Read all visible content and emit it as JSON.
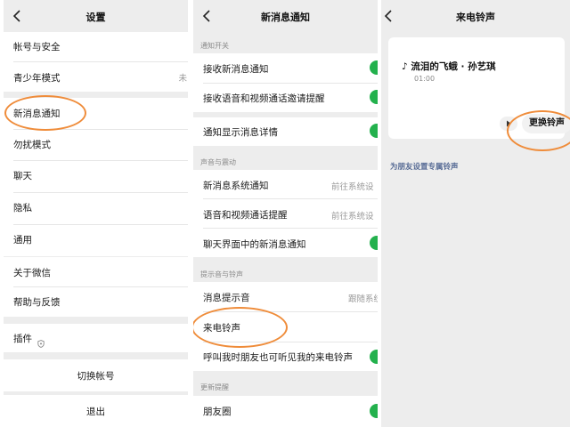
{
  "settings": {
    "title": "设置",
    "items": [
      {
        "label": "帐号与安全"
      },
      {
        "label": "青少年模式",
        "value": "未"
      },
      {
        "label": "新消息通知"
      },
      {
        "label": "勿扰模式"
      },
      {
        "label": "聊天"
      },
      {
        "label": "隐私"
      },
      {
        "label": "通用"
      },
      {
        "label": "关于微信"
      },
      {
        "label": "帮助与反馈"
      },
      {
        "label": "插件"
      }
    ],
    "switch_account": "切换帐号",
    "logout": "退出"
  },
  "notifications": {
    "title": "新消息通知",
    "sections": [
      {
        "label": "通知开关"
      },
      {
        "label": "声音与震动"
      },
      {
        "label": "提示音与铃声"
      },
      {
        "label": "更新提醒"
      }
    ],
    "items": [
      {
        "label": "接收新消息通知",
        "toggle": true
      },
      {
        "label": "接收语音和视频通话邀请提醒",
        "toggle": true
      },
      {
        "label": "通知显示消息详情",
        "toggle": true
      },
      {
        "label": "新消息系统通知",
        "value": "前往系统设"
      },
      {
        "label": "语音和视频通话提醒",
        "value": "前往系统设"
      },
      {
        "label": "聊天界面中的新消息通知",
        "toggle": true
      },
      {
        "label": "消息提示音",
        "value": "跟随系统"
      },
      {
        "label": "来电铃声"
      },
      {
        "label": "呼叫我时朋友也可听见我的来电铃声",
        "toggle": true
      },
      {
        "label": "朋友圈",
        "toggle": true
      }
    ]
  },
  "ringtone": {
    "title": "来电铃声",
    "song": "♪ 流泪的飞蛾 · 孙艺琪",
    "duration": "01:00",
    "change_button": "更换铃声",
    "friend_link": "为朋友设置专属铃声"
  },
  "colors": {
    "toggle_on": "#23b14d",
    "highlight": "#ef8c3a",
    "link": "#576b95",
    "background": "#ededed"
  }
}
